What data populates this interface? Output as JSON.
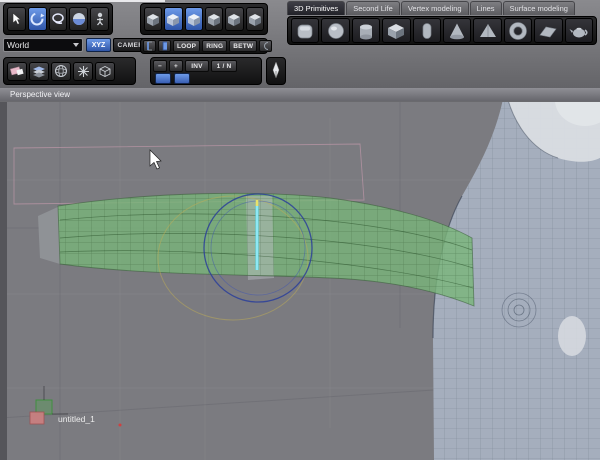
{
  "header": {
    "tabs": [
      {
        "label": "3D Primitives",
        "active": true
      },
      {
        "label": "Second Life",
        "active": false
      },
      {
        "label": "Vertex modeling",
        "active": false
      },
      {
        "label": "Lines",
        "active": false
      },
      {
        "label": "Surface modeling",
        "active": false
      }
    ],
    "world_selector": {
      "value": "World"
    },
    "xyz_button": "XYZ",
    "camera_button": "CAMERA",
    "loop_button": "LOOP",
    "ring_button": "RING",
    "betw_button": "BETW",
    "minus_button": "−",
    "plus_button": "+",
    "inv_button": "INV",
    "one_n_button": "1 / N",
    "primitive_icons": [
      "soft-cube",
      "sphere",
      "cylinder",
      "cube",
      "capsule",
      "cone",
      "pyramid",
      "torus",
      "plane",
      "teapot"
    ],
    "select_mode_icons": [
      "vertex-cube",
      "edge-cube",
      "face-cube",
      "object-cube",
      "loop-cube",
      "all-cube"
    ]
  },
  "viewport": {
    "label": "Perspective view",
    "filename": "untitled_1"
  },
  "colors": {
    "viewport_bg": "#7b7b80",
    "selection_green": "#7cb87c",
    "loop_cyan": "#52dcec",
    "manipulator_blue": "#2c3f9a",
    "manipulator_yellow": "#bfae55",
    "accent_blue": "#4a78d8"
  }
}
